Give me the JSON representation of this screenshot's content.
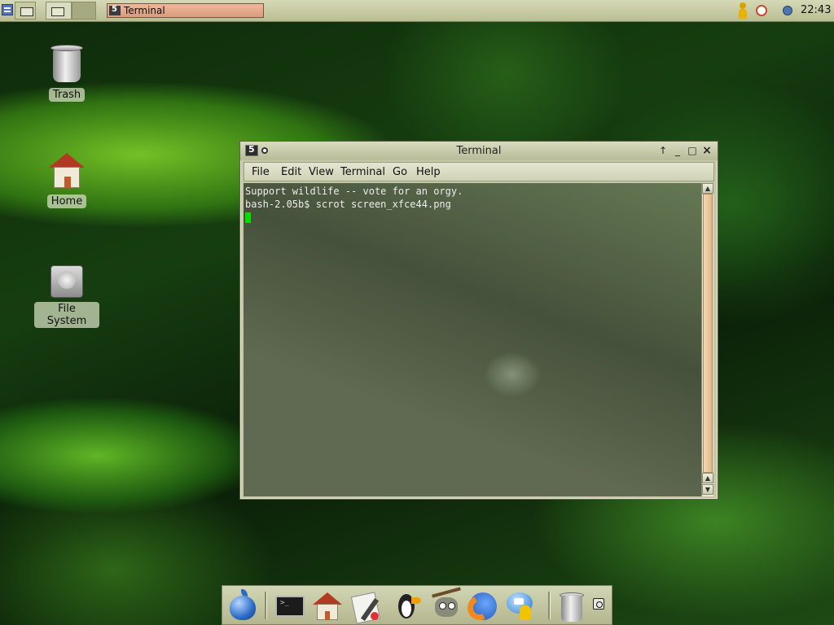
{
  "top_panel": {
    "taskbar": [
      {
        "label": "Terminal"
      }
    ],
    "clock": "22:43"
  },
  "desktop_icons": [
    {
      "label": "Trash",
      "icon": "trash-icon"
    },
    {
      "label": "Home",
      "icon": "home-icon"
    },
    {
      "label": "File System",
      "icon": "hard-drive-icon"
    }
  ],
  "terminal_window": {
    "title": "Terminal",
    "menu": [
      {
        "label": "File"
      },
      {
        "label": "Edit"
      },
      {
        "label": "View"
      },
      {
        "label": "Terminal"
      },
      {
        "label": "Go"
      },
      {
        "label": "Help"
      }
    ],
    "lines": [
      "Support wildlife -- vote for an orgy.",
      "bash-2.05b$ scrot screen_xfce44.png"
    ],
    "cursor_color": "#00e000"
  },
  "dock": {
    "items": [
      {
        "icon": "apple-menu-icon"
      },
      {
        "icon": "terminal-icon"
      },
      {
        "icon": "home-icon"
      },
      {
        "icon": "text-editor-icon"
      },
      {
        "icon": "email-bird-icon"
      },
      {
        "icon": "gimp-icon"
      },
      {
        "icon": "firefox-icon"
      },
      {
        "icon": "instant-messenger-icon"
      },
      {
        "icon": "trash-icon"
      },
      {
        "icon": "power-icon"
      }
    ]
  },
  "colors": {
    "panel": "#c9cca6",
    "taskbar_active": "#e8a98a",
    "scroll_thumb": "#ecc79c"
  }
}
